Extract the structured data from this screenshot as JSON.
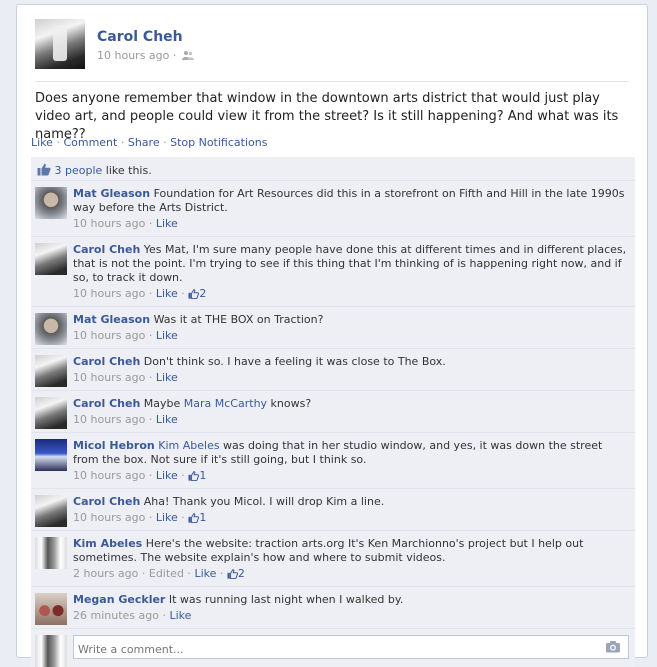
{
  "post": {
    "author": "Carol Cheh",
    "time": "10 hours ago",
    "meta_sep": "·",
    "body": "Does anyone remember that window in the downtown arts district that would just play video art, and people could view it from the street? Is it still happening? And what was its name??",
    "actions": {
      "like": "Like",
      "comment": "Comment",
      "share": "Share",
      "stop_notifications": "Stop Notifications",
      "sep": "·"
    }
  },
  "likes": {
    "count_link": "3 people",
    "suffix": " like this."
  },
  "comments": [
    {
      "author": "Mat Gleason",
      "text": "Foundation for Art Resources did this in a storefront on Fifth and Hill in the late 1990s way before the Arts District.",
      "time": "10 hours ago",
      "like": "Like",
      "avatar": "mat"
    },
    {
      "author": "Carol Cheh",
      "text": "Yes Mat, I'm sure many people have done this at different times and in different places, that is not the point. I'm trying to see if this thing that I'm thinking of is happening right now, and if so, to track it down.",
      "time": "10 hours ago",
      "like": "Like",
      "like_count": "2",
      "avatar": "carol"
    },
    {
      "author": "Mat Gleason",
      "text": "Was it at THE BOX on Traction?",
      "time": "10 hours ago",
      "like": "Like",
      "avatar": "mat"
    },
    {
      "author": "Carol Cheh",
      "text": "Don't think so. I have a feeling it was close to The Box.",
      "time": "10 hours ago",
      "like": "Like",
      "avatar": "carol"
    },
    {
      "author": "Carol Cheh",
      "text_before": "Maybe ",
      "mention": "Mara McCarthy",
      "text_after": " knows?",
      "time": "10 hours ago",
      "like": "Like",
      "avatar": "carol"
    },
    {
      "author": "Micol Hebron",
      "mention": "Kim Abeles",
      "text_after": " was doing that in her studio window, and yes, it was down the street from the box. Not sure if it's still going, but I think so.",
      "time": "10 hours ago",
      "like": "Like",
      "like_count": "1",
      "avatar": "micol"
    },
    {
      "author": "Carol Cheh",
      "text": "Aha! Thank you Micol. I will drop Kim a line.",
      "time": "10 hours ago",
      "like": "Like",
      "like_count": "1",
      "avatar": "carol"
    },
    {
      "author": "Kim Abeles",
      "text": "Here's the website: traction arts.org It's Ken Marchionno's project but I help out sometimes. The website explain's how and where to submit videos.",
      "time": "2 hours ago",
      "edited": "Edited",
      "like": "Like",
      "like_count": "2",
      "avatar": "kim"
    },
    {
      "author": "Megan Geckler",
      "text": "It was running last night when I walked by.",
      "time": "26 minutes ago",
      "like": "Like",
      "avatar": "megan"
    }
  ],
  "composer": {
    "placeholder": "Write a comment..."
  },
  "icons": {
    "audience": "people-icon",
    "like": "thumbs-up-icon",
    "photo": "camera-icon"
  },
  "colors": {
    "link": "#3b5998",
    "meta": "#999999",
    "ufi_bg": "#edeff4"
  }
}
